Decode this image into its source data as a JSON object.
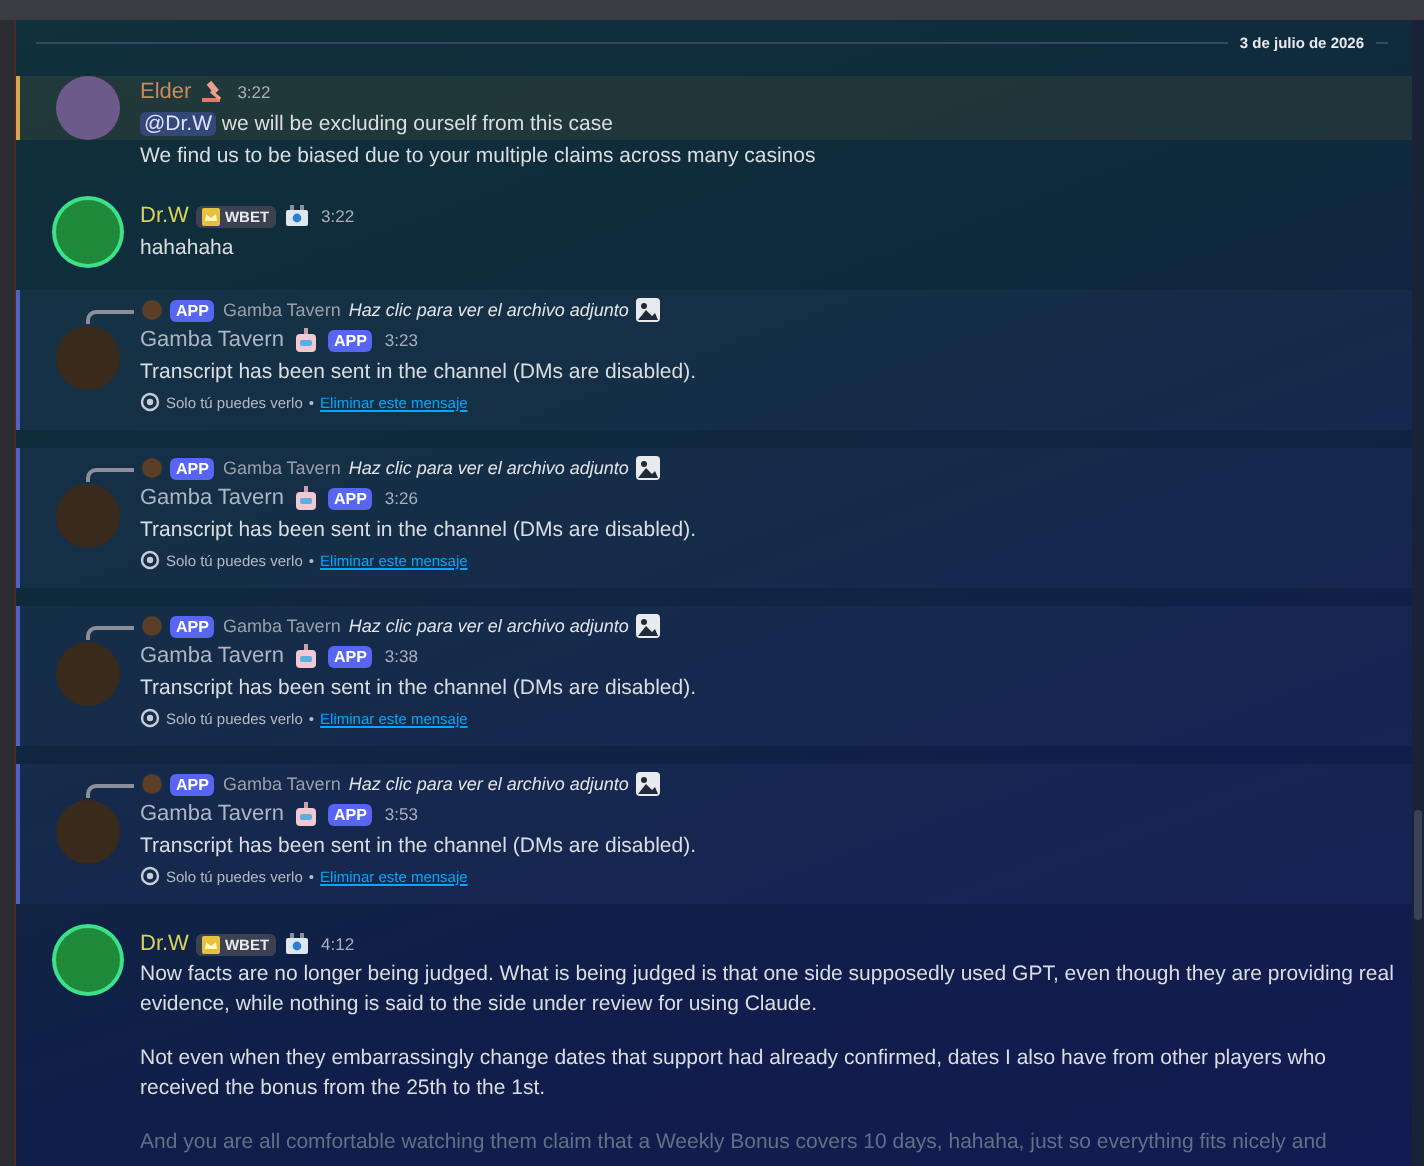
{
  "date_divider": "3 de julio de 2026",
  "messages": [
    {
      "kind": "user",
      "author": "Elder",
      "color": "#c98a5e",
      "time": "3:22",
      "highlighted": true,
      "mention": "@Dr.W",
      "text": "we will be excluding ourself from this case"
    },
    {
      "kind": "continuation",
      "highlighted": false,
      "text": "We find us to be biased due to your multiple claims across many casinos"
    },
    {
      "kind": "user",
      "author": "Dr.W",
      "color": "#d9d45c",
      "tag": "WBET",
      "time": "3:22",
      "highlighted": false,
      "text": "hahahaha"
    },
    {
      "kind": "ephemeral",
      "reply_badge": "APP",
      "reply_author": "Gamba Tavern",
      "reply_text": "Haz clic para ver el archivo adjunto",
      "author": "Gamba Tavern",
      "color": "#aeb6c4",
      "app_badge": "APP",
      "time": "3:23",
      "text": "Transcript has been sent in the channel (DMs are disabled).",
      "note": "Solo tú puedes verlo",
      "separator": "•",
      "link": "Eliminar este mensaje"
    },
    {
      "kind": "ephemeral",
      "reply_badge": "APP",
      "reply_author": "Gamba Tavern",
      "reply_text": "Haz clic para ver el archivo adjunto",
      "author": "Gamba Tavern",
      "color": "#aeb6c4",
      "app_badge": "APP",
      "time": "3:26",
      "text": "Transcript has been sent in the channel (DMs are disabled).",
      "note": "Solo tú puedes verlo",
      "separator": "•",
      "link": "Eliminar este mensaje"
    },
    {
      "kind": "ephemeral",
      "reply_badge": "APP",
      "reply_author": "Gamba Tavern",
      "reply_text": "Haz clic para ver el archivo adjunto",
      "author": "Gamba Tavern",
      "color": "#aeb6c4",
      "app_badge": "APP",
      "time": "3:38",
      "text": "Transcript has been sent in the channel (DMs are disabled).",
      "note": "Solo tú puedes verlo",
      "separator": "•",
      "link": "Eliminar este mensaje"
    },
    {
      "kind": "ephemeral",
      "reply_badge": "APP",
      "reply_author": "Gamba Tavern",
      "reply_text": "Haz clic para ver el archivo adjunto",
      "author": "Gamba Tavern",
      "color": "#aeb6c4",
      "app_badge": "APP",
      "time": "3:53",
      "text": "Transcript has been sent in the channel (DMs are disabled).",
      "note": "Solo tú puedes verlo",
      "separator": "•",
      "link": "Eliminar este mensaje"
    },
    {
      "kind": "user",
      "author": "Dr.W",
      "color": "#d9d45c",
      "tag": "WBET",
      "time": "4:12",
      "highlighted": false,
      "paragraphs": [
        "Now facts are no longer being judged. What is being judged is that one side supposedly used GPT, even though they are providing real evidence, while nothing is said to the side under review for using Claude.",
        "Not even when they embarrassingly change dates that support had already confirmed, dates I also have from other players who received the bonus from the 25th to the 1st.",
        "And you are all comfortable watching them claim that a Weekly Bonus covers 10 days, hahaha, just so everything fits nicely and"
      ]
    }
  ]
}
